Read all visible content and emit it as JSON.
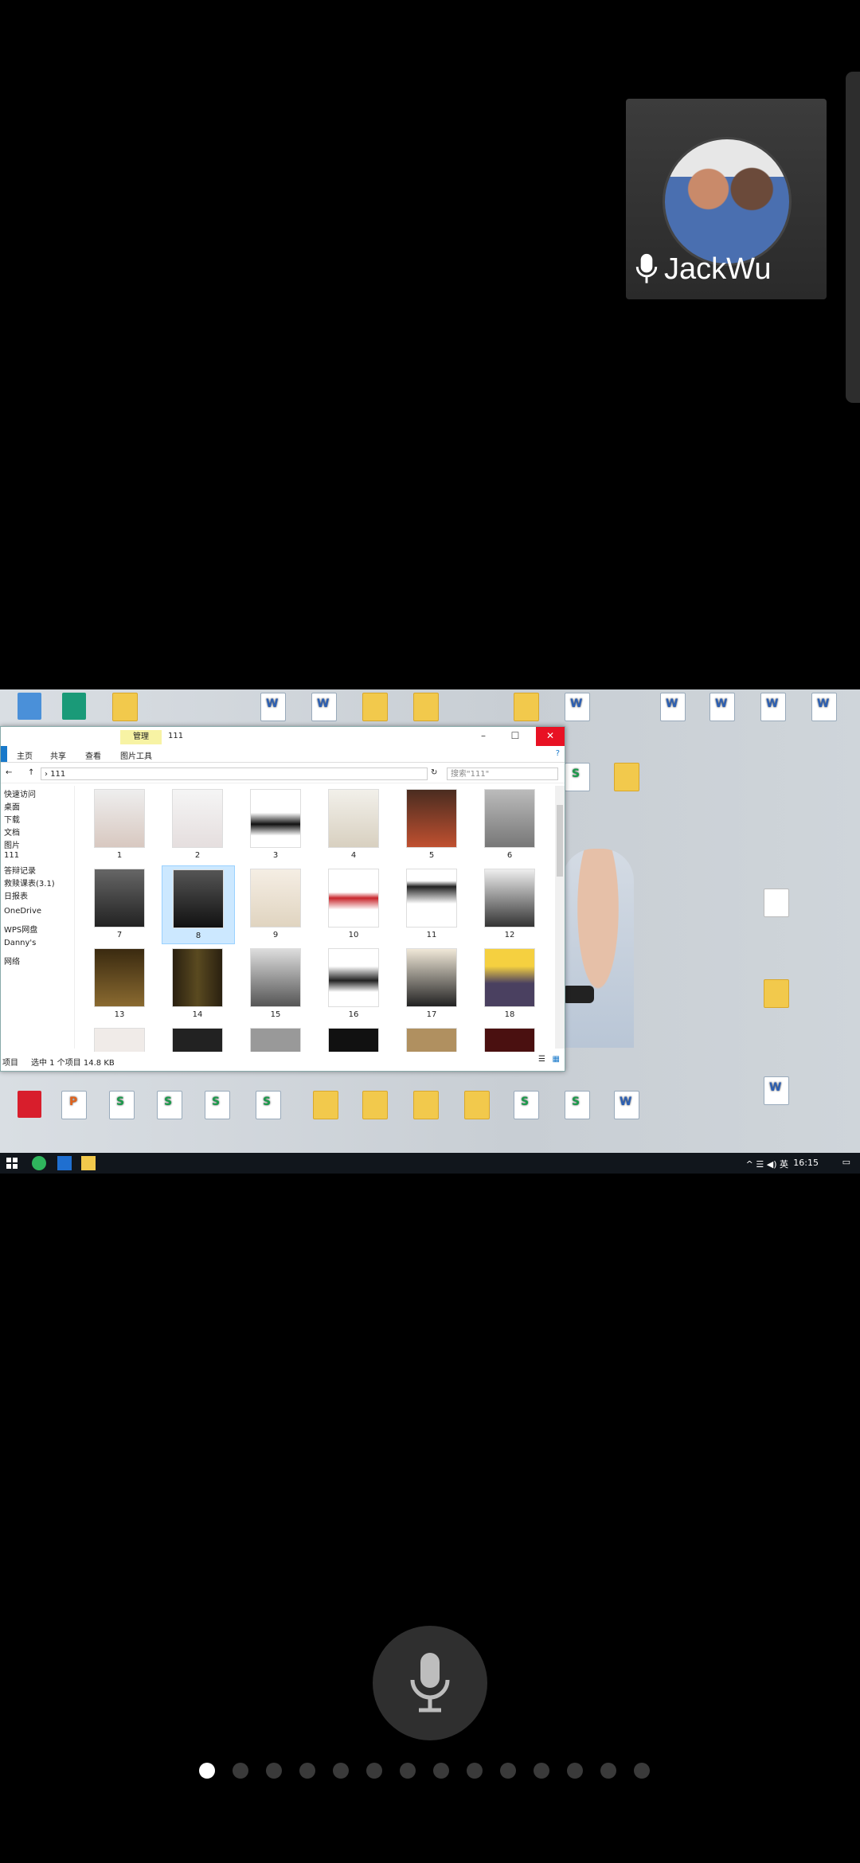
{
  "participant": {
    "name": "JackWu"
  },
  "explorer": {
    "manage_tab": "管理",
    "window_title": "111",
    "ribbon_tabs": [
      "主页",
      "共享",
      "查看",
      "图片工具"
    ],
    "path": "111",
    "search_placeholder": "搜索\"111\"",
    "nav_items": [
      "快速访问",
      "桌面",
      "下载",
      "文档",
      "图片",
      "111",
      "答辩记录",
      "救赎课表(3.1)",
      "日报表",
      "OneDrive",
      "WPS网盘",
      "Danny's",
      "网络"
    ],
    "thumbnails": [
      "1",
      "2",
      "3",
      "4",
      "5",
      "6",
      "7",
      "8",
      "9",
      "10",
      "11",
      "12",
      "13",
      "14",
      "15",
      "16",
      "17",
      "18"
    ],
    "selected_item": "8",
    "status": {
      "items": "项目",
      "selection": "选中 1 个项目 14.8 KB"
    }
  },
  "taskbar": {
    "ime": "英",
    "time": "16:15"
  },
  "colors": {
    "close_button": "#e81123",
    "selected_item": "#cce8ff",
    "manage_tab": "#f7f3a4"
  },
  "pager": {
    "pages": 14,
    "active": 1
  }
}
